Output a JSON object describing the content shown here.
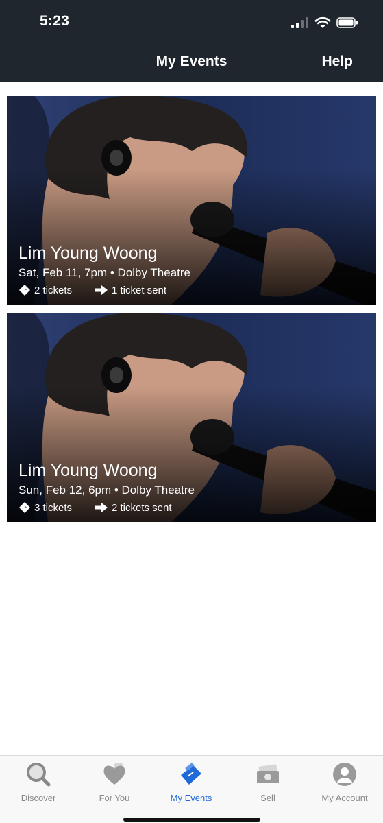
{
  "status_bar": {
    "time": "5:23"
  },
  "header": {
    "title": "My Events",
    "help_label": "Help"
  },
  "events": [
    {
      "name": "Lim Young Woong",
      "details": "Sat, Feb 11, 7pm • Dolby Theatre",
      "tickets": "2 tickets",
      "sent": "1 ticket sent"
    },
    {
      "name": "Lim Young Woong",
      "details": "Sun, Feb 12, 6pm • Dolby Theatre",
      "tickets": "3 tickets",
      "sent": "2 tickets sent"
    }
  ],
  "nav": {
    "discover": "Discover",
    "for_you": "For You",
    "my_events": "My Events",
    "sell": "Sell",
    "my_account": "My Account"
  },
  "colors": {
    "header_bg": "#1f262d",
    "active_tab": "#1f6ad8",
    "inactive_tab": "#8a8a8a"
  }
}
